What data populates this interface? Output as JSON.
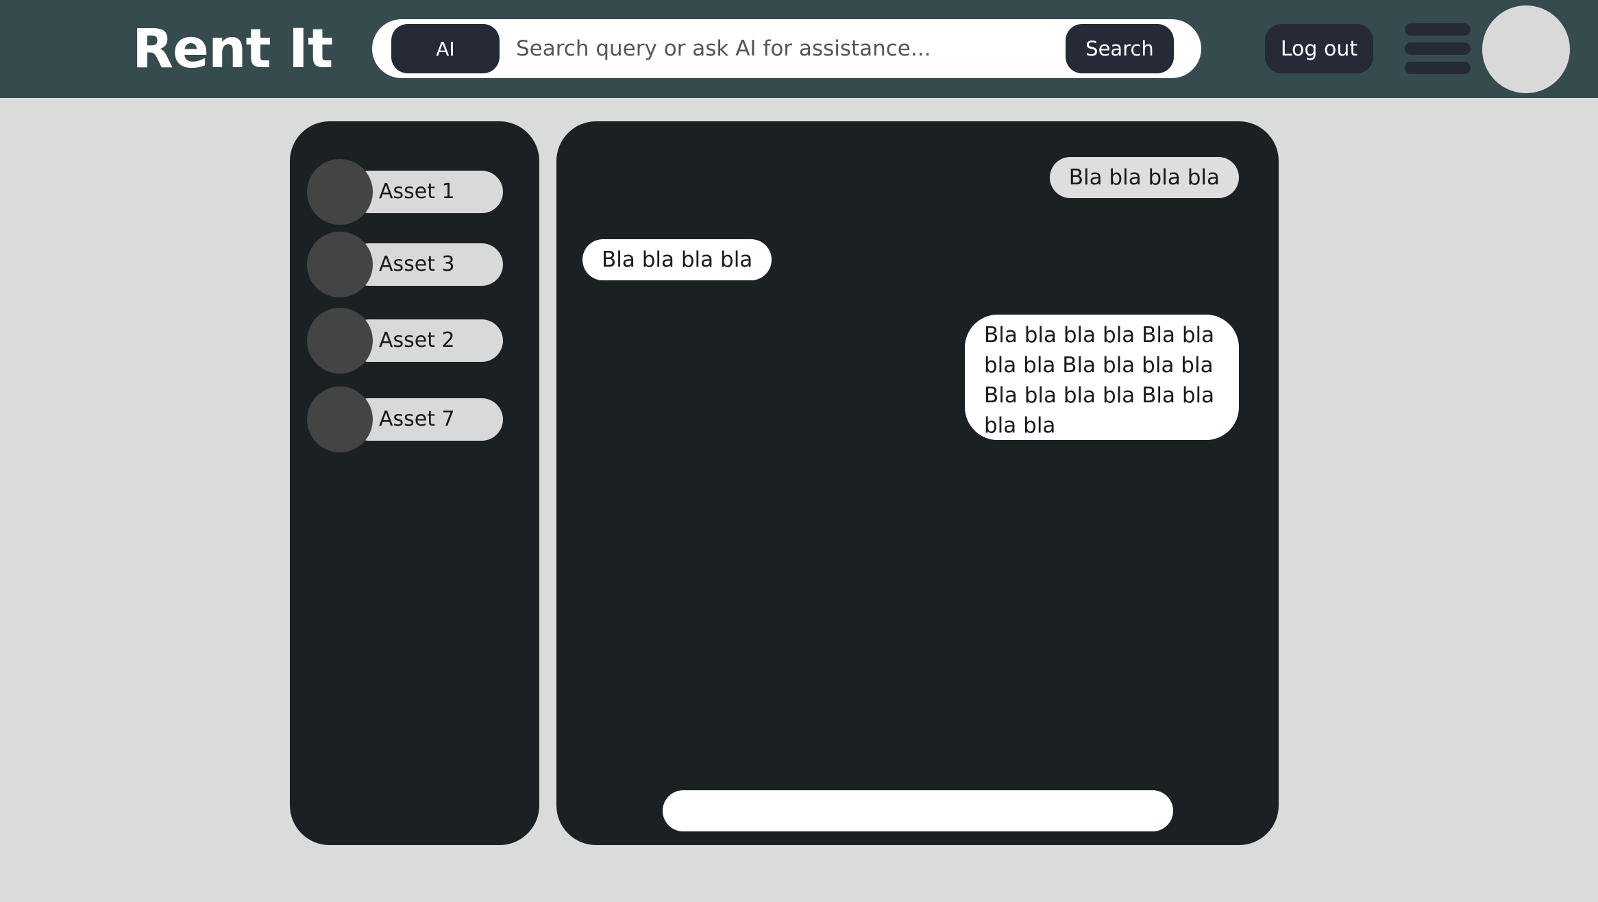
{
  "header": {
    "logo": "Rent It",
    "ai_label": "AI",
    "search_placeholder": "Search query or ask AI for assistance...",
    "search_label": "Search",
    "logout_label": "Log out"
  },
  "sidebar": {
    "assets": [
      {
        "label": "Asset 1"
      },
      {
        "label": "Asset 3"
      },
      {
        "label": "Asset 2"
      },
      {
        "label": "Asset 7"
      }
    ]
  },
  "chat": {
    "messages": [
      {
        "text": "Bla bla bla bla",
        "side": "right"
      },
      {
        "text": "Bla bla bla bla",
        "side": "left"
      },
      {
        "text": "Bla bla bla bla Bla bla bla bla Bla bla bla bla Bla bla bla bla Bla bla bla bla",
        "side": "right"
      }
    ],
    "input_value": ""
  }
}
